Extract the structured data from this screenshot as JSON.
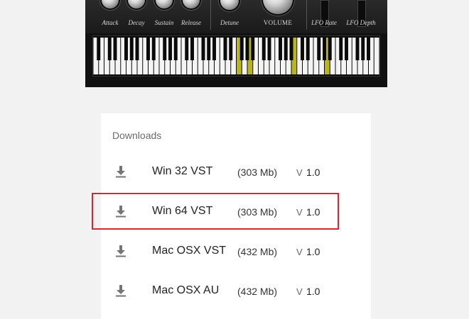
{
  "synth": {
    "knobs": [
      {
        "label": "Attack",
        "icon": "knob-icon"
      },
      {
        "label": "Decay",
        "icon": "knob-icon"
      },
      {
        "label": "Sustain",
        "icon": "knob-icon"
      },
      {
        "label": "Release",
        "icon": "knob-icon"
      },
      {
        "label": "Detune",
        "icon": "knob-icon"
      }
    ],
    "volume_label": "VOLUME",
    "lfo_rate_label": "LFO Rate",
    "lfo_depth_label": "LFO Depth",
    "highlighted_key_color": "#b9b51b"
  },
  "downloads": {
    "title": "Downloads",
    "items": [
      {
        "name": "Win 32 VST",
        "size": "(303 Mb)",
        "version_prefix": "V",
        "version": "1.0",
        "icon": "download-icon"
      },
      {
        "name": "Win 64 VST",
        "size": "(303 Mb)",
        "version_prefix": "V",
        "version": "1.0",
        "icon": "download-icon",
        "highlighted": true
      },
      {
        "name": "Mac OSX VST",
        "size": "(432 Mb)",
        "version_prefix": "V",
        "version": "1.0",
        "icon": "download-icon"
      },
      {
        "name": "Mac OSX AU",
        "size": "(432 Mb)",
        "version_prefix": "V",
        "version": "1.0",
        "icon": "download-icon"
      }
    ],
    "highlight_color": "#d8262e"
  }
}
